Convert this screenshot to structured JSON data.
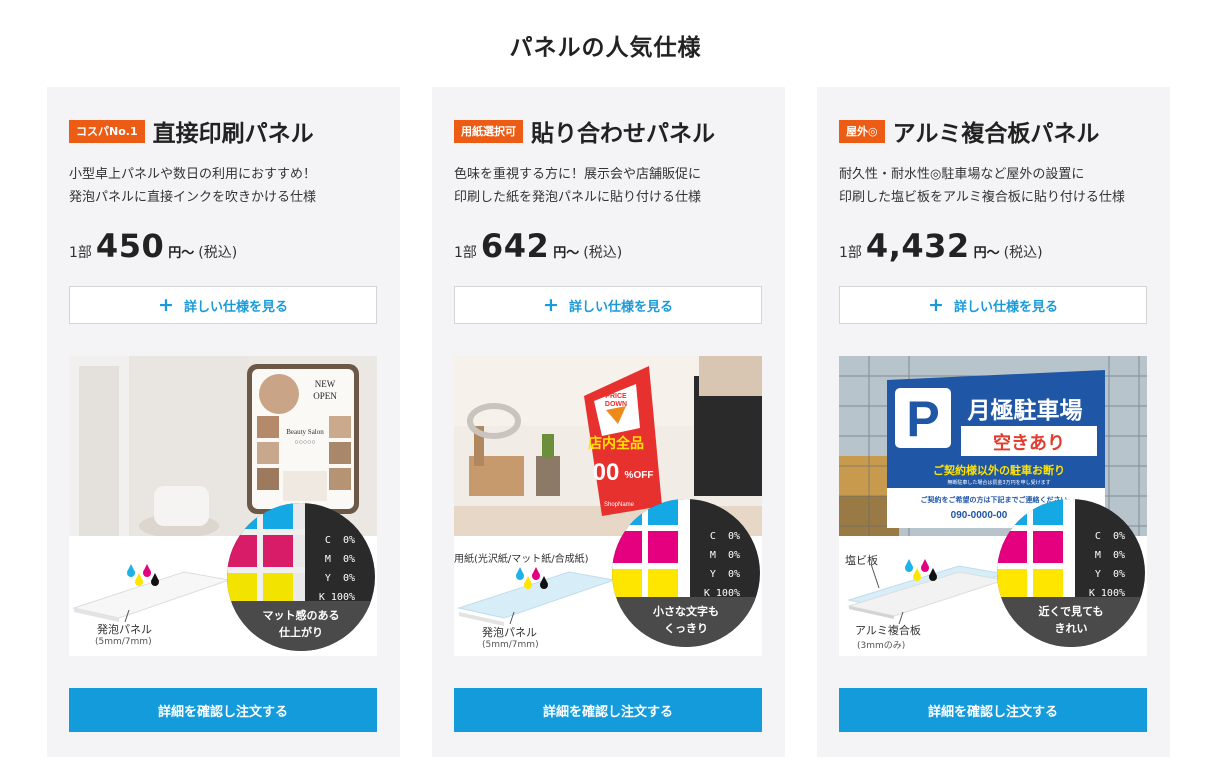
{
  "section_title": "パネルの人気仕様",
  "cards": [
    {
      "badge": "コスパNo.1",
      "title": "直接印刷パネル",
      "desc": [
        "小型卓上パネルや数日の利用におすすめ！",
        "発泡パネルに直接インクを吹きかける仕様"
      ],
      "price_pre": "1部",
      "price": "450",
      "price_unit": "円〜",
      "tax": "(税込)",
      "spec_label": "詳しい仕様を見る",
      "order_label": "詳細を確認し注文する",
      "board_label": "発泡パネル",
      "board_sub": "(5mm/7mm)",
      "zoom_caption": [
        "マット感のある",
        "仕上がり"
      ],
      "photo_text": {
        "open": "NEW",
        "open2": "OPEN",
        "salon": "Beauty Salon",
        "dots": "○○○○○"
      }
    },
    {
      "badge": "用紙選択可",
      "title": "貼り合わせパネル",
      "desc": [
        "色味を重視する方に！展示会や店舗販促に",
        "印刷した紙を発泡パネルに貼り付ける仕様"
      ],
      "price_pre": "1部",
      "price": "642",
      "price_unit": "円〜",
      "tax": "(税込)",
      "spec_label": "詳しい仕様を見る",
      "order_label": "詳細を確認し注文する",
      "paper_label": "用紙(光沢紙/マット紙/合成紙)",
      "board_label": "発泡パネル",
      "board_sub": "(5mm/7mm)",
      "zoom_caption": [
        "小さな文字も",
        "くっきり"
      ],
      "photo_text": {
        "price_down": "PRICE",
        "price_down2": "DOWN",
        "sale": "店内全品",
        "pct": "00",
        "off": "%OFF",
        "shop": "ShopName"
      }
    },
    {
      "badge": "屋外◎",
      "title": "アルミ複合板パネル",
      "desc": [
        "耐久性・耐水性◎駐車場など屋外の設置に",
        "印刷した塩ビ板をアルミ複合板に貼り付ける仕様"
      ],
      "price_pre": "1部",
      "price": "4,432",
      "price_unit": "円〜",
      "tax": "(税込)",
      "spec_label": "詳しい仕様を見る",
      "order_label": "詳細を確認し注文する",
      "paper_label": "塩ビ板",
      "board_label": "アルミ複合板",
      "board_sub": "(3mmのみ)",
      "zoom_caption": [
        "近くで見ても",
        "きれい"
      ],
      "photo_text": {
        "p": "P",
        "lot": "月極駐車場",
        "vacant": "空きあり",
        "notice": "ご契約様以外の駐車お断り",
        "small": "無断駐車した場合は罰金3万円を申し受けます",
        "contact": "ご契約をご希望の方は下記までご連絡ください",
        "tel": "090-0000-00"
      }
    }
  ],
  "cmyk": [
    "C",
    "M",
    "Y",
    "K"
  ],
  "cmyk_values": [
    "0%",
    "0%",
    "0%",
    "100%"
  ],
  "colors": {
    "accent": "#139bdc",
    "badge": "#ec5c14",
    "card_bg": "#f4f4f6"
  }
}
